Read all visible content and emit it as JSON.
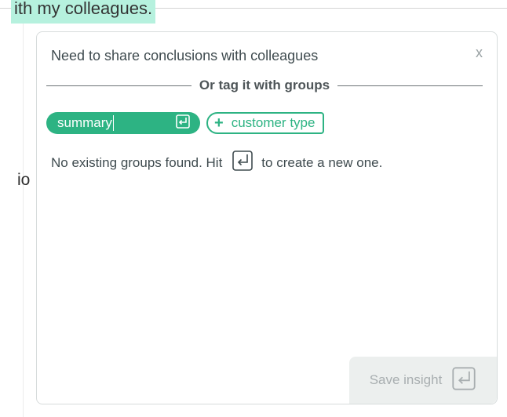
{
  "background": {
    "highlighted_text": "ith my colleagues.",
    "fragment_text": "io"
  },
  "popup": {
    "title": "Need to share conclusions with colleagues",
    "close_label": "x",
    "divider_text": "Or tag it with groups",
    "tag_input_value": "summary",
    "tag_suggestion_label": "customer type",
    "add_icon": "plus-icon",
    "enter_icon": "enter-key-icon",
    "hint_prefix": "No existing groups found. Hit",
    "hint_suffix": "to create a new one.",
    "save_button_label": "Save insight"
  },
  "colors": {
    "accent": "#2db383",
    "highlight": "#b6f1de",
    "button_bg": "#ecefee",
    "button_text": "#a8aeb0"
  }
}
